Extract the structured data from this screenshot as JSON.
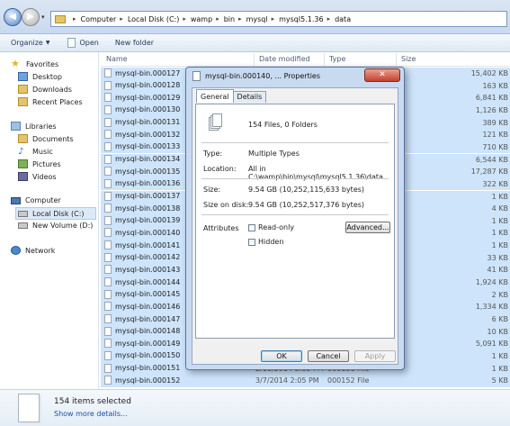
{
  "address": {
    "crumbs": [
      "Computer",
      "Local Disk (C:)",
      "wamp",
      "bin",
      "mysql",
      "mysql5.1.36",
      "data"
    ]
  },
  "toolbar": {
    "organize": "Organize",
    "open": "Open",
    "new_folder": "New folder"
  },
  "sidebar": {
    "favorites": "Favorites",
    "desktop": "Desktop",
    "downloads": "Downloads",
    "recent": "Recent Places",
    "libraries": "Libraries",
    "documents": "Documents",
    "music": "Music",
    "pictures": "Pictures",
    "videos": "Videos",
    "computer": "Computer",
    "local_disk": "Local Disk (C:)",
    "new_volume": "New Volume (D:)",
    "network": "Network"
  },
  "columns": {
    "name": "Name",
    "date": "Date modified",
    "type": "Type",
    "size": "Size"
  },
  "rows": [
    {
      "name": "mysql-bin.000127",
      "date": "",
      "type": "",
      "size": "15,402 KB"
    },
    {
      "name": "mysql-bin.000128",
      "date": "",
      "type": "",
      "size": "163 KB"
    },
    {
      "name": "mysql-bin.000129",
      "date": "",
      "type": "",
      "size": "6,841 KB"
    },
    {
      "name": "mysql-bin.000130",
      "date": "",
      "type": "",
      "size": "1,126 KB"
    },
    {
      "name": "mysql-bin.000131",
      "date": "",
      "type": "",
      "size": "389 KB"
    },
    {
      "name": "mysql-bin.000132",
      "date": "",
      "type": "",
      "size": "121 KB"
    },
    {
      "name": "mysql-bin.000133",
      "date": "",
      "type": "",
      "size": "710 KB"
    },
    {
      "name": "mysql-bin.000134",
      "date": "",
      "type": "",
      "size": "6,544 KB"
    },
    {
      "name": "mysql-bin.000135",
      "date": "",
      "type": "",
      "size": "17,287 KB"
    },
    {
      "name": "mysql-bin.000136",
      "date": "",
      "type": "",
      "size": "322 KB"
    },
    {
      "name": "mysql-bin.000137",
      "date": "",
      "type": "",
      "size": "1 KB"
    },
    {
      "name": "mysql-bin.000138",
      "date": "",
      "type": "",
      "size": "4 KB"
    },
    {
      "name": "mysql-bin.000139",
      "date": "",
      "type": "",
      "size": "1 KB"
    },
    {
      "name": "mysql-bin.000140",
      "date": "",
      "type": "",
      "size": "1 KB"
    },
    {
      "name": "mysql-bin.000141",
      "date": "",
      "type": "",
      "size": "1 KB"
    },
    {
      "name": "mysql-bin.000142",
      "date": "",
      "type": "",
      "size": "33 KB"
    },
    {
      "name": "mysql-bin.000143",
      "date": "",
      "type": "",
      "size": "41 KB"
    },
    {
      "name": "mysql-bin.000144",
      "date": "",
      "type": "",
      "size": "1,924 KB"
    },
    {
      "name": "mysql-bin.000145",
      "date": "",
      "type": "",
      "size": "2 KB"
    },
    {
      "name": "mysql-bin.000146",
      "date": "",
      "type": "",
      "size": "1,334 KB"
    },
    {
      "name": "mysql-bin.000147",
      "date": "",
      "type": "",
      "size": "6 KB"
    },
    {
      "name": "mysql-bin.000148",
      "date": "",
      "type": "",
      "size": "10 KB"
    },
    {
      "name": "mysql-bin.000149",
      "date": "",
      "type": "",
      "size": "5,091 KB"
    },
    {
      "name": "mysql-bin.000150",
      "date": "",
      "type": "",
      "size": "1 KB"
    },
    {
      "name": "mysql-bin.000151",
      "date": "2/10/2014 2:05 PM",
      "type": "000151 File",
      "size": "1 KB"
    },
    {
      "name": "mysql-bin.000152",
      "date": "3/7/2014 2:05 PM",
      "type": "000152 File",
      "size": "5 KB"
    }
  ],
  "details": {
    "count": "154 items selected",
    "more": "Show more details..."
  },
  "dialog": {
    "title": "mysql-bin.000140, ... Properties",
    "close": "✕",
    "tab_general": "General",
    "tab_details": "Details",
    "summary": "154 Files, 0 Folders",
    "type_label": "Type:",
    "type_value": "Multiple Types",
    "location_label": "Location:",
    "location_value": "All in C:\\wamp\\bin\\mysql\\mysql5.1.36\\data",
    "size_label": "Size:",
    "size_value": "9.54 GB (10,252,115,633 bytes)",
    "disk_label": "Size on disk:",
    "disk_value": "9.54 GB (10,252,517,376 bytes)",
    "attributes_label": "Attributes",
    "readonly": "Read-only",
    "hidden": "Hidden",
    "advanced": "Advanced...",
    "ok": "OK",
    "cancel": "Cancel",
    "apply": "Apply"
  }
}
